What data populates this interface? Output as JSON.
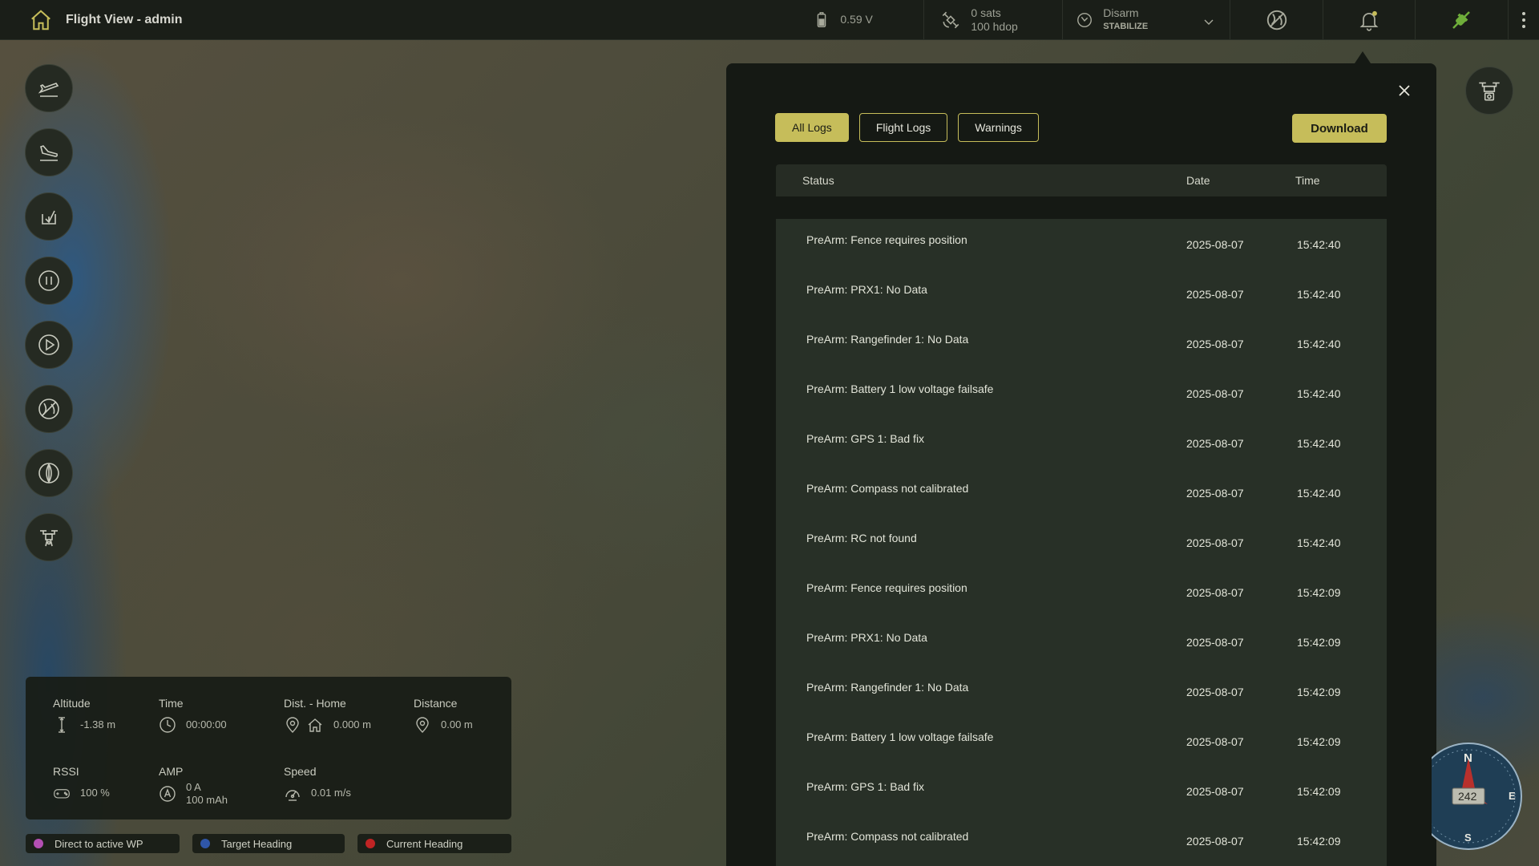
{
  "topbar": {
    "title": "Flight View - admin",
    "battery_voltage": "0.59 V",
    "gps_sats": "0 sats",
    "gps_hdop": "100 hdop",
    "arm_state": "Disarm",
    "flight_mode": "STABILIZE"
  },
  "telemetry": {
    "altitude_label": "Altitude",
    "altitude_value": "-1.38 m",
    "time_label": "Time",
    "time_value": "00:00:00",
    "dist_home_label": "Dist. - Home",
    "dist_home_value": "0.000 m",
    "distance_label": "Distance",
    "distance_value": "0.00 m",
    "rssi_label": "RSSI",
    "rssi_value": "100 %",
    "amp_label": "AMP",
    "amp_current": "0 A",
    "amp_capacity": "100 mAh",
    "speed_label": "Speed",
    "speed_value": "0.01 m/s"
  },
  "legend": [
    {
      "label": "Direct to active WP",
      "color": "#b34fb3"
    },
    {
      "label": "Target Heading",
      "color": "#2f56a8"
    },
    {
      "label": "Current Heading",
      "color": "#c02424"
    }
  ],
  "logs": {
    "tabs": [
      {
        "label": "All Logs",
        "active": true
      },
      {
        "label": "Flight Logs",
        "active": false
      },
      {
        "label": "Warnings",
        "active": false
      }
    ],
    "download_label": "Download",
    "columns": {
      "status": "Status",
      "date": "Date",
      "time": "Time"
    },
    "rows": [
      {
        "status": "PreArm: Fence requires position",
        "date": "2025-08-07",
        "time": "15:42:40"
      },
      {
        "status": "PreArm: PRX1: No Data",
        "date": "2025-08-07",
        "time": "15:42:40"
      },
      {
        "status": "PreArm: Rangefinder 1: No Data",
        "date": "2025-08-07",
        "time": "15:42:40"
      },
      {
        "status": "PreArm: Battery 1 low voltage failsafe",
        "date": "2025-08-07",
        "time": "15:42:40"
      },
      {
        "status": "PreArm: GPS 1: Bad fix",
        "date": "2025-08-07",
        "time": "15:42:40"
      },
      {
        "status": "PreArm: Compass not calibrated",
        "date": "2025-08-07",
        "time": "15:42:40"
      },
      {
        "status": "PreArm: RC not found",
        "date": "2025-08-07",
        "time": "15:42:40"
      },
      {
        "status": "PreArm: Fence requires position",
        "date": "2025-08-07",
        "time": "15:42:09"
      },
      {
        "status": "PreArm: PRX1: No Data",
        "date": "2025-08-07",
        "time": "15:42:09"
      },
      {
        "status": "PreArm: Rangefinder 1: No Data",
        "date": "2025-08-07",
        "time": "15:42:09"
      },
      {
        "status": "PreArm: Battery 1 low voltage failsafe",
        "date": "2025-08-07",
        "time": "15:42:09"
      },
      {
        "status": "PreArm: GPS 1: Bad fix",
        "date": "2025-08-07",
        "time": "15:42:09"
      },
      {
        "status": "PreArm: Compass not calibrated",
        "date": "2025-08-07",
        "time": "15:42:09"
      }
    ]
  },
  "compass": {
    "heading": "242",
    "n": "N",
    "e": "E",
    "s": "S"
  },
  "colors": {
    "accent": "#c6bd5a",
    "topbar_bg": "#1a1e18",
    "panel_bg": "#151914",
    "row_bg": "#283027"
  },
  "icons": {
    "home": "home-icon",
    "battery": "battery-icon",
    "satellite": "satellite-icon",
    "arm": "arm-icon",
    "gps_off": "gps-off-icon",
    "bell": "bell-icon",
    "link": "link-icon",
    "menu": "kebab-menu-icon"
  }
}
